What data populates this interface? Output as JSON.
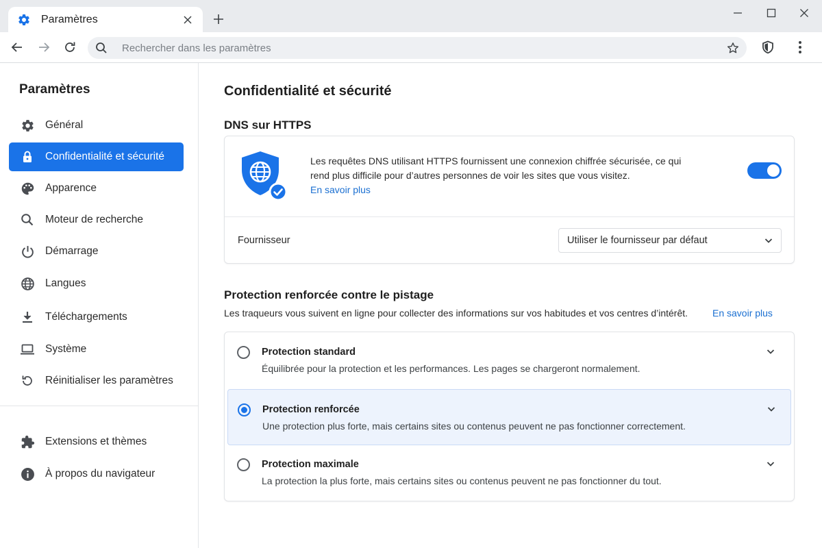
{
  "window": {
    "tab_title": "Paramètres"
  },
  "toolbar": {
    "search_placeholder": "Rechercher dans les paramètres"
  },
  "sidebar": {
    "title": "Paramètres",
    "items": [
      {
        "label": "Général",
        "icon": "gear-icon"
      },
      {
        "label": "Confidentialité et sécurité",
        "icon": "lock-icon",
        "active": true
      },
      {
        "label": "Apparence",
        "icon": "palette-icon"
      },
      {
        "label": "Moteur de recherche",
        "icon": "search-icon"
      },
      {
        "label": "Démarrage",
        "icon": "power-icon"
      },
      {
        "label": "Langues",
        "icon": "globe-icon"
      },
      {
        "label": "Téléchargements",
        "icon": "download-icon"
      },
      {
        "label": "Système",
        "icon": "laptop-icon"
      },
      {
        "label": "Réinitialiser les paramètres",
        "icon": "reset-icon"
      }
    ],
    "footer_items": [
      {
        "label": "Extensions et thèmes",
        "icon": "puzzle-icon"
      },
      {
        "label": "À propos du navigateur",
        "icon": "info-icon"
      }
    ]
  },
  "main": {
    "page_title": "Confidentialité et sécurité",
    "dns": {
      "title": "DNS sur HTTPS",
      "description": "Les requêtes DNS utilisant HTTPS fournissent une connexion chiffrée sécurisée, ce qui rend plus difficile pour d’autres personnes de voir les sites que vous visitez.",
      "learn_more": "En savoir plus",
      "enabled": true,
      "provider_label": "Fournisseur",
      "provider_value": "Utiliser le fournisseur par défaut"
    },
    "tracking": {
      "title": "Protection renforcée contre le pistage",
      "description": "Les traqueurs vous suivent en ligne pour collecter des informations sur vos habitudes et vos centres d’intérêt.",
      "learn_more": "En savoir plus",
      "options": [
        {
          "title": "Protection standard",
          "subtitle": "Équilibrée pour la protection et les performances. Les pages se chargeront normalement.",
          "selected": false
        },
        {
          "title": "Protection renforcée",
          "subtitle": "Une protection plus forte, mais certains sites ou contenus peuvent ne pas fonctionner correctement.",
          "selected": true
        },
        {
          "title": "Protection maximale",
          "subtitle": "La protection la plus forte, mais certains sites ou contenus peuvent ne pas fonctionner du tout.",
          "selected": false
        }
      ]
    }
  },
  "colors": {
    "accent": "#1a73e8",
    "link": "#1a6fd1",
    "selected_bg": "#edf3fd"
  }
}
